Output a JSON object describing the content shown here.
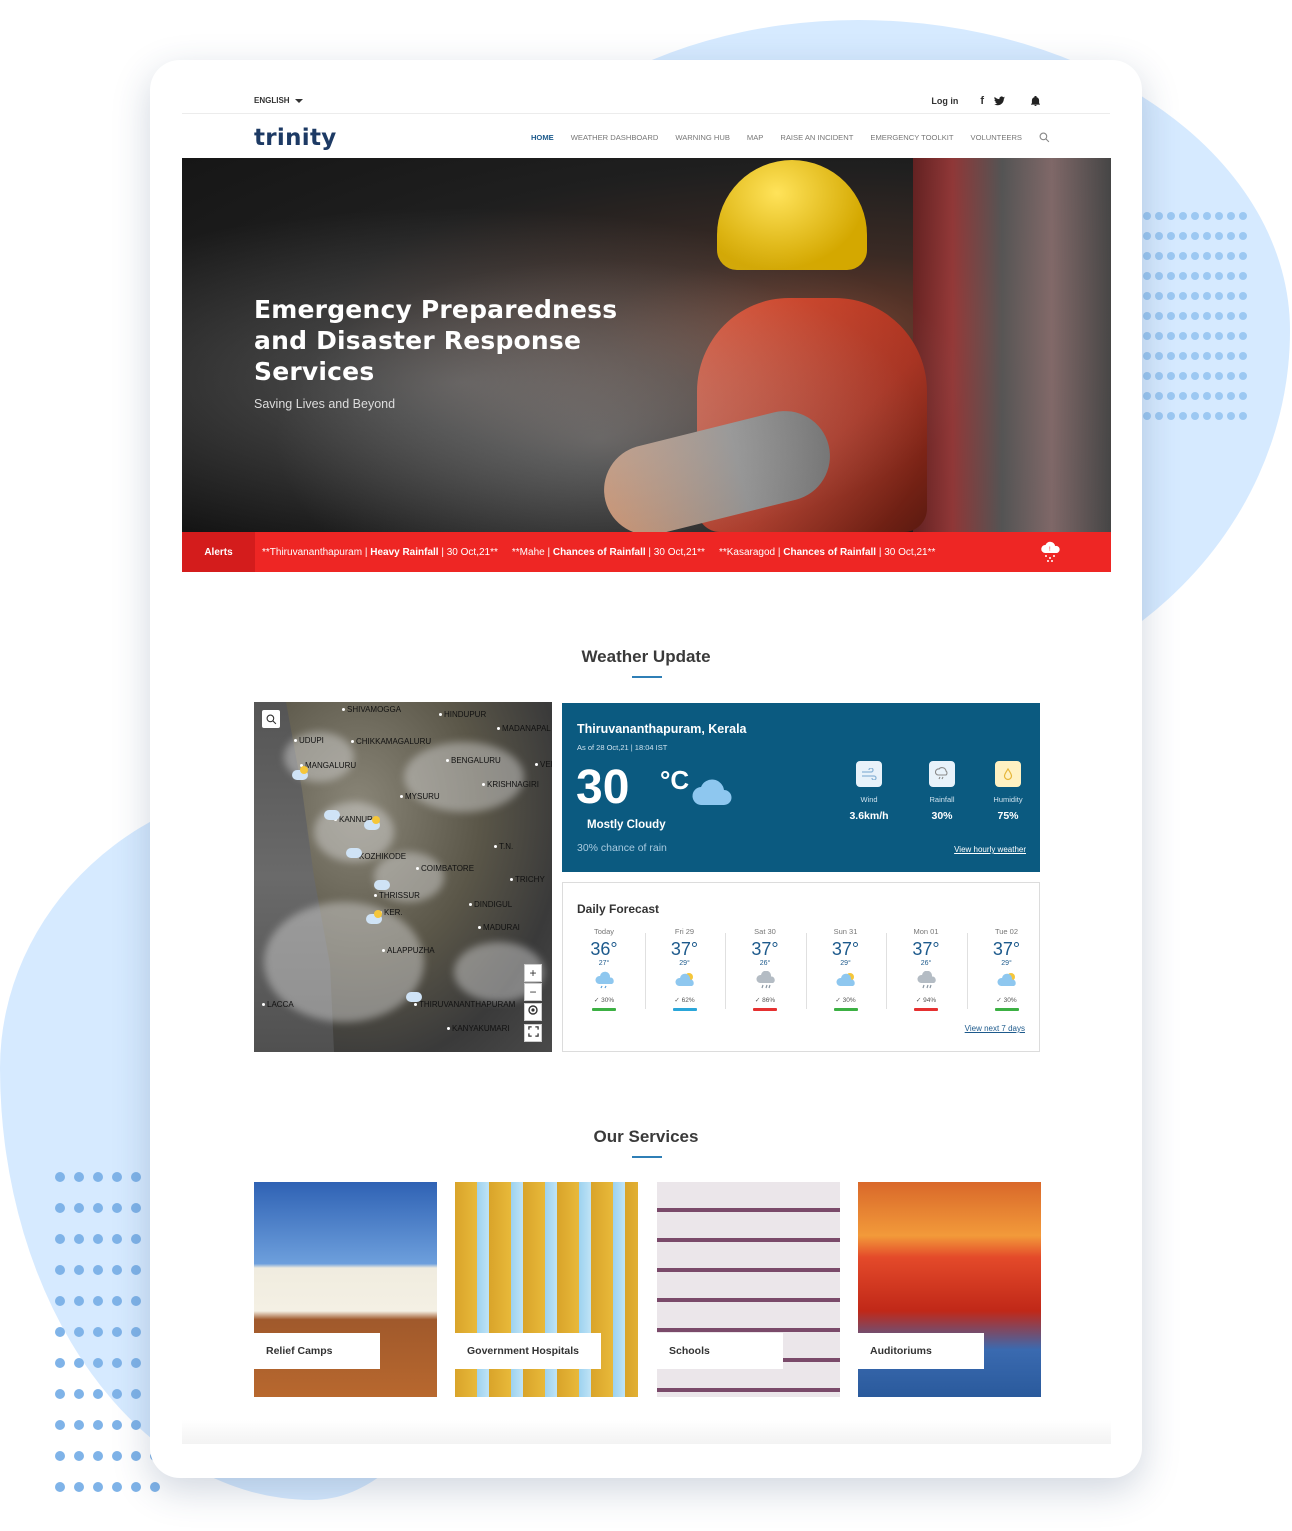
{
  "topbar": {
    "language": "ENGLISH",
    "login": "Log in",
    "facebook_glyph": "f",
    "icons": [
      "facebook-icon",
      "twitter-icon",
      "bell-icon"
    ]
  },
  "brand": {
    "logo_text": "trinity"
  },
  "nav": {
    "items": [
      {
        "label": "HOME",
        "active": true
      },
      {
        "label": "WEATHER DASHBOARD",
        "active": false
      },
      {
        "label": "WARNING HUB",
        "active": false
      },
      {
        "label": "MAP",
        "active": false
      },
      {
        "label": "RAISE AN INCIDENT",
        "active": false
      },
      {
        "label": "EMERGENCY TOOLKIT",
        "active": false
      },
      {
        "label": "VOLUNTEERS",
        "active": false
      }
    ]
  },
  "hero": {
    "title": "Emergency Preparedness and Disaster Response Services",
    "subtitle": "Saving Lives and Beyond"
  },
  "alerts": {
    "label": "Alerts",
    "items": [
      {
        "prefix": "**Thiruvananthapuram | ",
        "type": "Heavy Rainfall",
        "suffix": " | 30 Oct,21**"
      },
      {
        "prefix": "**Mahe | ",
        "type": "Chances of Rainfall",
        "suffix": " | 30 Oct,21**"
      },
      {
        "prefix": "**Kasaragod | ",
        "type": "Chances of Rainfall",
        "suffix": " | 30 Oct,21**"
      }
    ]
  },
  "weather_section": {
    "title": "Weather Update"
  },
  "map": {
    "labels": [
      "SHIVAMOGGA",
      "HINDUPUR",
      "MADANAPAL",
      "UDUPI",
      "CHIKKAMAGALURU",
      "MANGALURU",
      "BENGALURU",
      "VEL",
      "KRISHNAGIRI",
      "MYSURU",
      "KANNUR",
      "KOZHIKODE",
      "T.N.",
      "COIMBATORE",
      "TRICHY",
      "THRISSUR",
      "DINDIGUL",
      "KER.",
      "MADURAI",
      "ALAPPUZHA",
      "THIRUVANANTHAPURAM",
      "KANYAKUMARI",
      "LACCA"
    ],
    "zoom_in": "+",
    "zoom_out": "−"
  },
  "current": {
    "location": "Thiruvananthapuram, Kerala",
    "as_of": "As of 28 Oct,21 | 18:04 IST",
    "temp": "30",
    "unit": "°C",
    "condition": "Mostly Cloudy",
    "chance": "30% chance of rain",
    "metrics": [
      {
        "label": "Wind",
        "value": "3.6km/h",
        "icon": "wind-icon"
      },
      {
        "label": "Rainfall",
        "value": "30%",
        "icon": "rainfall-icon"
      },
      {
        "label": "Humidity",
        "value": "75%",
        "icon": "humidity-icon"
      }
    ],
    "link": "View hourly weather"
  },
  "daily": {
    "title": "Daily Forecast",
    "days": [
      {
        "name": "Today",
        "high": "36°",
        "low": "27°",
        "rain": "✓ 30%",
        "icon": "rain-cloud-icon",
        "bar_color": "#3cb043"
      },
      {
        "name": "Fri 29",
        "high": "37°",
        "low": "29°",
        "rain": "✓ 62%",
        "icon": "sun-cloud-icon",
        "bar_color": "#2aa6d9"
      },
      {
        "name": "Sat 30",
        "high": "37°",
        "low": "26°",
        "rain": "✓ 86%",
        "icon": "storm-cloud-icon",
        "bar_color": "#e53030"
      },
      {
        "name": "Sun 31",
        "high": "37°",
        "low": "29°",
        "rain": "✓ 30%",
        "icon": "sun-cloud-icon",
        "bar_color": "#3cb043"
      },
      {
        "name": "Mon 01",
        "high": "37°",
        "low": "26°",
        "rain": "✓ 94%",
        "icon": "storm-cloud-icon",
        "bar_color": "#e53030"
      },
      {
        "name": "Tue 02",
        "high": "37°",
        "low": "29°",
        "rain": "✓ 30%",
        "icon": "sun-cloud-icon",
        "bar_color": "#3cb043"
      }
    ],
    "link": "View next 7 days"
  },
  "services": {
    "title": "Our Services",
    "items": [
      {
        "label": "Relief Camps"
      },
      {
        "label": "Government Hospitals"
      },
      {
        "label": "Schools"
      },
      {
        "label": "Auditoriums"
      }
    ]
  },
  "colors": {
    "accent": "#1d5a8c",
    "alert_red": "#ee2624",
    "weather_panel": "#0b5a80",
    "background_blob": "#d6eaff"
  }
}
